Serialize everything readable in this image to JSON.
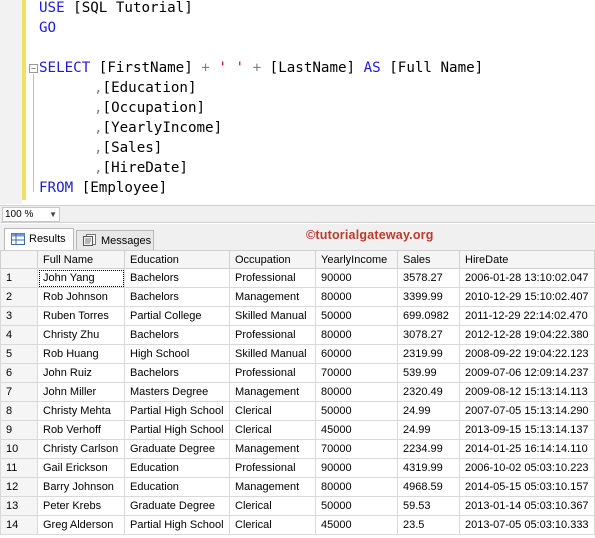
{
  "editor": {
    "line1": {
      "kw": "USE",
      "rest": " [SQL Tutorial]"
    },
    "line2": {
      "kw": "GO"
    },
    "line4": {
      "kw": "SELECT",
      "p1": " [FirstName] ",
      "op1": "+",
      "sp": " ",
      "str": "' '",
      "sp2": " ",
      "op2": "+",
      "p2": " [LastName] ",
      "as": "AS",
      "p3": " [Full Name]"
    },
    "line5": {
      "comma": ",",
      "col": "[Education]"
    },
    "line6": {
      "comma": ",",
      "col": "[Occupation]"
    },
    "line7": {
      "comma": ",",
      "col": "[YearlyIncome]"
    },
    "line8": {
      "comma": ",",
      "col": "[Sales]"
    },
    "line9": {
      "comma": ",",
      "col": "[HireDate]"
    },
    "line10": {
      "kw": "FROM",
      "rest": " [Employee]"
    },
    "fold_glyph": "−"
  },
  "zoom": {
    "value": "100 %",
    "arrow": "▼"
  },
  "tabs": {
    "results": "Results",
    "messages": "Messages"
  },
  "watermark": "©tutorialgateway.org",
  "grid": {
    "columns": [
      "",
      "Full Name",
      "Education",
      "Occupation",
      "YearlyIncome",
      "Sales",
      "HireDate"
    ],
    "rows": [
      [
        "1",
        "John Yang",
        "Bachelors",
        "Professional",
        "90000",
        "3578.27",
        "2006-01-28 13:10:02.047"
      ],
      [
        "2",
        "Rob Johnson",
        "Bachelors",
        "Management",
        "80000",
        "3399.99",
        "2010-12-29 15:10:02.407"
      ],
      [
        "3",
        "Ruben Torres",
        "Partial College",
        "Skilled Manual",
        "50000",
        "699.0982",
        "2011-12-29 22:14:02.470"
      ],
      [
        "4",
        "Christy Zhu",
        "Bachelors",
        "Professional",
        "80000",
        "3078.27",
        "2012-12-28 19:04:22.380"
      ],
      [
        "5",
        "Rob Huang",
        "High School",
        "Skilled Manual",
        "60000",
        "2319.99",
        "2008-09-22 19:04:22.123"
      ],
      [
        "6",
        "John Ruiz",
        "Bachelors",
        "Professional",
        "70000",
        "539.99",
        "2009-07-06 12:09:14.237"
      ],
      [
        "7",
        "John Miller",
        "Masters Degree",
        "Management",
        "80000",
        "2320.49",
        "2009-08-12 15:13:14.113"
      ],
      [
        "8",
        "Christy Mehta",
        "Partial High School",
        "Clerical",
        "50000",
        "24.99",
        "2007-07-05 15:13:14.290"
      ],
      [
        "9",
        "Rob Verhoff",
        "Partial High School",
        "Clerical",
        "45000",
        "24.99",
        "2013-09-15 15:13:14.137"
      ],
      [
        "10",
        "Christy Carlson",
        "Graduate Degree",
        "Management",
        "70000",
        "2234.99",
        "2014-01-25 16:14:14.110"
      ],
      [
        "11",
        "Gail Erickson",
        "Education",
        "Professional",
        "90000",
        "4319.99",
        "2006-10-02 05:03:10.223"
      ],
      [
        "12",
        "Barry Johnson",
        "Education",
        "Management",
        "80000",
        "4968.59",
        "2014-05-15 05:03:10.157"
      ],
      [
        "13",
        "Peter Krebs",
        "Graduate Degree",
        "Clerical",
        "50000",
        "59.53",
        "2013-01-14 05:03:10.367"
      ],
      [
        "14",
        "Greg Alderson",
        "Partial High School",
        "Clerical",
        "45000",
        "23.5",
        "2013-07-05 05:03:10.333"
      ]
    ]
  }
}
